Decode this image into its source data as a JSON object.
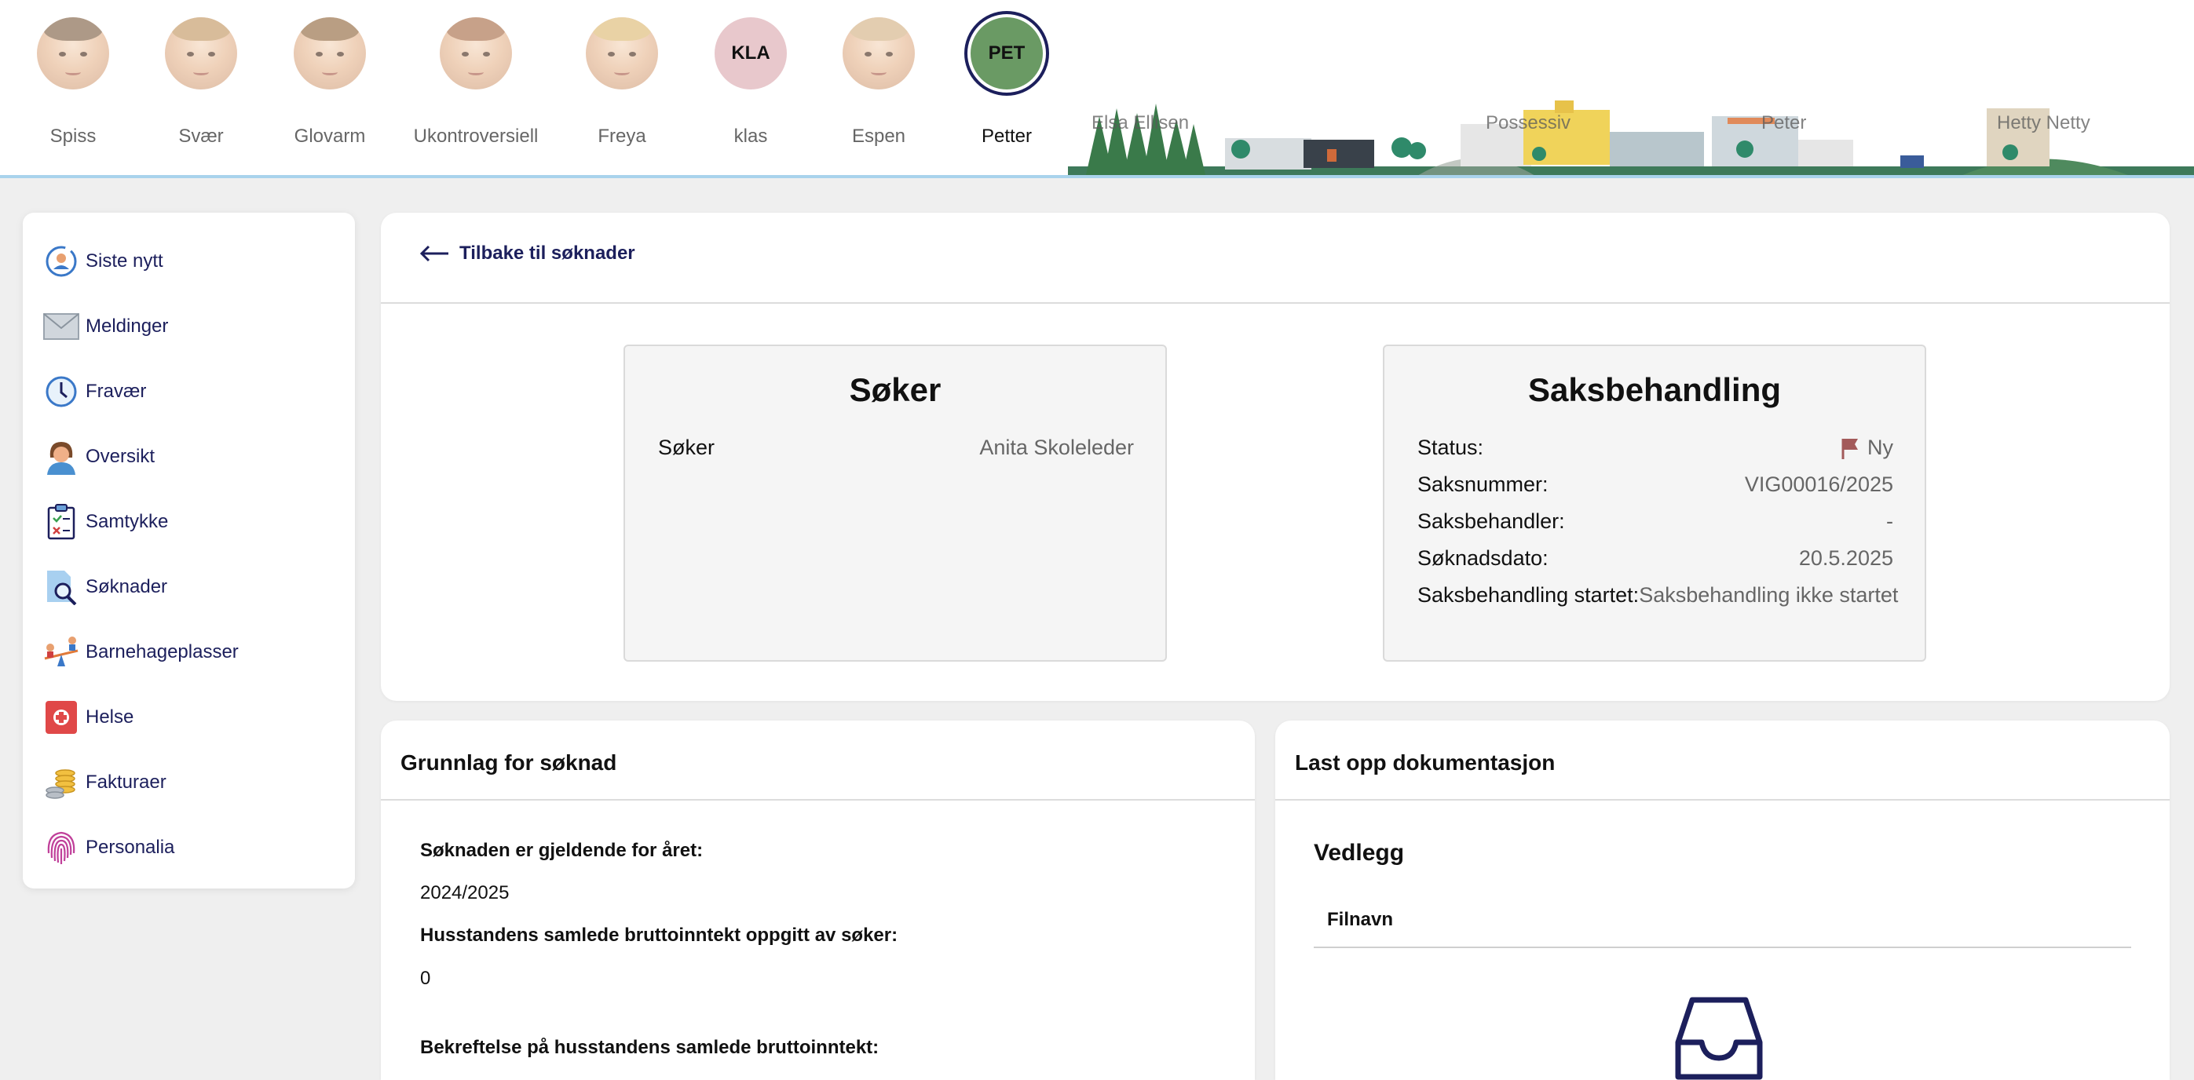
{
  "children": [
    {
      "name": "Spiss",
      "avatar": "photo",
      "hair": "#8b6f55"
    },
    {
      "name": "Svær",
      "avatar": "photo",
      "hair": "#c8a070"
    },
    {
      "name": "Glovarm",
      "avatar": "photo",
      "hair": "#9c7650"
    },
    {
      "name": "Ukontroversiell",
      "avatar": "photo",
      "hair": "#b07a58"
    },
    {
      "name": "Freya",
      "avatar": "photo",
      "hair": "#e0c080"
    },
    {
      "name": "klas",
      "avatar": "initials",
      "initials": "KLA",
      "color": "#e8c8cc"
    },
    {
      "name": "Espen",
      "avatar": "photo",
      "hair": "#d8b890"
    },
    {
      "name": "Petter",
      "avatar": "initials",
      "initials": "PET",
      "color": "#6a9a64",
      "active": true
    }
  ],
  "skyline_labels": [
    "Elsa Ellisen",
    "Possessiv",
    "Peter",
    "Hetty Netty"
  ],
  "sidebar": {
    "items": [
      {
        "label": "Siste nytt",
        "icon": "news-icon"
      },
      {
        "label": "Meldinger",
        "icon": "envelope-icon"
      },
      {
        "label": "Fravær",
        "icon": "clock-icon"
      },
      {
        "label": "Oversikt",
        "icon": "person-icon"
      },
      {
        "label": "Samtykke",
        "icon": "clipboard-icon"
      },
      {
        "label": "Søknader",
        "icon": "document-search-icon"
      },
      {
        "label": "Barnehageplasser",
        "icon": "seesaw-icon"
      },
      {
        "label": "Helse",
        "icon": "first-aid-icon"
      },
      {
        "label": "Fakturaer",
        "icon": "coins-icon"
      },
      {
        "label": "Personalia",
        "icon": "fingerprint-icon"
      }
    ]
  },
  "back_link": "Tilbake til søknader",
  "soker": {
    "title": "Søker",
    "rows": [
      {
        "label": "Søker",
        "value": "Anita Skoleleder"
      }
    ]
  },
  "saksbehandling": {
    "title": "Saksbehandling",
    "status_label": "Status:",
    "status_value": "Ny",
    "rows": [
      {
        "label": "Saksnummer:",
        "value": "VIG00016/2025"
      },
      {
        "label": "Saksbehandler:",
        "value": "-"
      },
      {
        "label": "Søknadsdato:",
        "value": "20.5.2025"
      },
      {
        "label": "Saksbehandling startet:",
        "value": "Saksbehandling ikke startet"
      }
    ]
  },
  "grunnlag": {
    "title": "Grunnlag for søknad",
    "year_label": "Søknaden er gjeldende for året:",
    "year_value": "2024/2025",
    "income_label": "Husstandens samlede bruttoinntekt oppgitt av søker:",
    "income_value": "0",
    "confirm_label": "Bekreftelse på husstandens samlede bruttoinntekt:"
  },
  "upload": {
    "title": "Last opp dokumentasjon",
    "section": "Vedlegg",
    "column_filename": "Filnavn"
  },
  "colors": {
    "navy": "#1c1f5c",
    "status_flag": "#a35a5a"
  }
}
